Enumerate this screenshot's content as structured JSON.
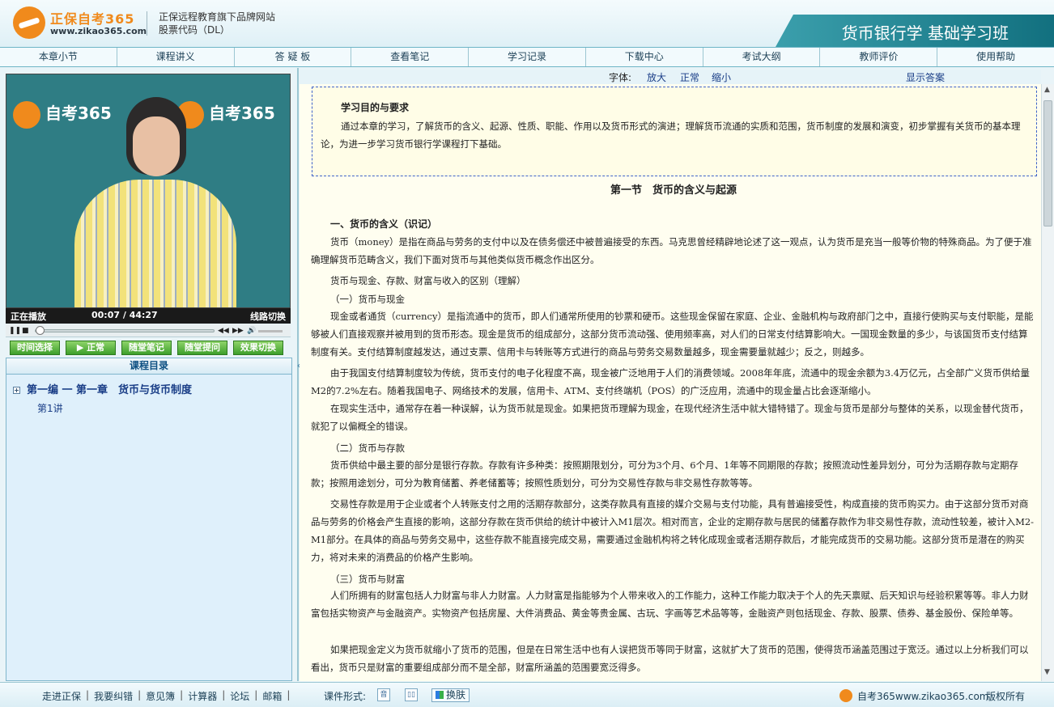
{
  "header": {
    "logo_text": "正保自考365",
    "logo_url": "www.zikao365.com",
    "brand_line1": "正保远程教育旗下品牌网站",
    "brand_line2": "股票代码（DL）",
    "course_title": "货币银行学 基础学习班"
  },
  "nav": [
    {
      "label": "本章小节"
    },
    {
      "label": "课程讲义"
    },
    {
      "label": "答 疑 板"
    },
    {
      "label": "查看笔记"
    },
    {
      "label": "学习记录"
    },
    {
      "label": "下载中心"
    },
    {
      "label": "考试大纲"
    },
    {
      "label": "教师评价"
    },
    {
      "label": "使用帮助"
    }
  ],
  "video": {
    "logo_text": "自考365",
    "logo_url": "www.zikao365.com",
    "status": "正在播放",
    "time": "00:07 / 44:27",
    "switch_label": "线路切换",
    "progress_fraction": 0.003
  },
  "player_buttons": {
    "time_select": "时间选择",
    "normal": "▶ 正常",
    "note": "随堂笔记",
    "question": "随堂提问",
    "effect_switch": "效果切换"
  },
  "catalog": {
    "title": "课程目录",
    "node": "第一编 一 第一章　货币与货币制度",
    "lesson": "第1讲"
  },
  "font_bar": {
    "label": "字体:",
    "large": "放大",
    "normal": "正常",
    "small": "缩小",
    "show_answer": "显示答案"
  },
  "content": {
    "goals_title": "学习目的与要求",
    "goals_text": "通过本章的学习，了解货币的含义、起源、性质、职能、作用以及货币形式的演进；理解货币流通的实质和范围，货币制度的发展和演变，初步掌握有关货币的基本理论，为进一步学习货币银行学课程打下基础。",
    "section_title": "第一节　货币的含义与起源",
    "h1": "一、货币的含义（识记）",
    "p1": "货币（money）是指在商品与劳务的支付中以及在债务偿还中被普遍接受的东西。马克思曾经精辟地论述了这一观点，认为货币是充当一般等价物的特殊商品。为了便于准确理解货币范畴含义，我们下面对货币与其他类似货币概念作出区分。",
    "p2": "货币与现金、存款、财富与收入的区别（理解）",
    "s1": "（一）货币与现金",
    "p3": "现金或者通货（currency）是指流通中的货币，即人们通常所使用的钞票和硬币。这些现金保留在家庭、企业、金融机构与政府部门之中，直接行使购买与支付职能，是能够被人们直接观察并被用到的货币形态。现金是货币的组成部分，这部分货币流动强、使用频率高，对人们的日常支付结算影响大。一国现金数量的多少，与该国货币支付结算制度有关。支付结算制度越发达，通过支票、信用卡与转账等方式进行的商品与劳务交易数量越多，现金需要量就越少；反之，则越多。",
    "p4": "由于我国支付结算制度较为传统，货币支付的电子化程度不高，现金被广泛地用于人们的消费领域。2008年年底，流通中的现金余额为3.4万亿元，占全部广义货币供给量M2的7.2%左右。随着我国电子、网络技术的发展，信用卡、ATM、支付终端机（POS）的广泛应用，流通中的现金量占比会逐渐缩小。",
    "p5": "在现实生活中，通常存在着一种误解，认为货币就是现金。如果把货币理解为现金，在现代经济生活中就大错特错了。现金与货币是部分与整体的关系，以现金替代货币，就犯了以偏概全的错误。",
    "s2": "（二）货币与存款",
    "p6": "货币供给中最主要的部分是银行存款。存款有许多种类：按照期限划分，可分为3个月、6个月、1年等不同期限的存款；按照流动性差异划分，可分为活期存款与定期存款；按照用途划分，可分为教育储蓄、养老储蓄等；按照性质划分，可分为交易性存款与非交易性存款等等。",
    "p7": "交易性存款是用于企业或者个人转账支付之用的活期存款部分，这类存款具有直接的媒介交易与支付功能，具有普遍接受性，构成直接的货币购买力。由于这部分货币对商品与劳务的价格会产生直接的影响，这部分存款在货币供给的统计中被计入M1层次。相对而言，企业的定期存款与居民的储蓄存款作为非交易性存款，流动性较差，被计入M2-M1部分。在具体的商品与劳务交易中，这些存款不能直接完成交易，需要通过金融机构将之转化成现金或者活期存款后，才能完成货币的交易功能。这部分货币是潜在的购买力，将对未来的消费品的价格产生影响。",
    "s3": "（三）货币与财富",
    "p8": "人们所拥有的财富包括人力财富与非人力财富。人力财富是指能够为个人带来收入的工作能力，这种工作能力取决于个人的先天禀赋、后天知识与经验积累等等。非人力财富包括实物资产与金融资产。实物资产包括房屋、大件消费品、黄金等贵金属、古玩、字画等艺术品等等，金融资产则包括现金、存款、股票、债券、基金股份、保险单等。",
    "p9": "如果把现金定义为货币就缩小了货币的范围，但是在日常生活中也有人误把货币等同于财富，这就扩大了货币的范围，使得货币涵盖范围过于宽泛。通过以上分析我们可以看出，货币只是财富的重要组成部分而不是全部，财富所涵盖的范围要宽泛得多。"
  },
  "footer": {
    "links": [
      "走进正保",
      "我要纠错",
      "意见簿",
      "计算器",
      "论坛",
      "邮箱"
    ],
    "form_label": "课件形式:",
    "skin_label": "换肤",
    "site": "自考365www.zikao365.com",
    "copyright": "版权所有"
  }
}
